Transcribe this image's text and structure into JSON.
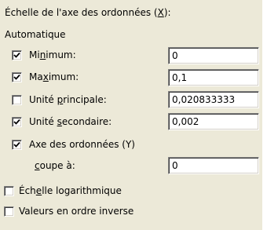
{
  "section_title": {
    "before": "Échelle de l'axe des ordonnées (",
    "key": "X",
    "after": "):"
  },
  "group_label": "Automatique",
  "rows": [
    {
      "label_before": "Mi",
      "label_key": "n",
      "label_after": "imum:",
      "checked": true,
      "value": "0"
    },
    {
      "label_before": "Ma",
      "label_key": "x",
      "label_after": "imum:",
      "checked": true,
      "value": "0,1"
    },
    {
      "label_before": "Unité ",
      "label_key": "p",
      "label_after": "rincipale:",
      "checked": false,
      "value": "0,020833333"
    },
    {
      "label_before": "Unité ",
      "label_key": "s",
      "label_after": "econdaire:",
      "checked": true,
      "value": "0,002"
    }
  ],
  "crosses": {
    "label": "Axe des ordonnées (Y)",
    "checked": true,
    "sub_label_key": "c",
    "sub_label_after": "oupe à:",
    "value": "0"
  },
  "options": [
    {
      "label_before": "Éch",
      "label_key": "e",
      "label_after": "lle logarithmique",
      "checked": false
    },
    {
      "label_before": "",
      "label_key": "",
      "label_after": "Valeurs en ordre inverse",
      "checked": false
    }
  ],
  "icons": {
    "checkmark": "check-icon"
  },
  "colors": {
    "dialog_bg": "#ece9d8",
    "field_bg": "#ffffff",
    "text": "#000000"
  }
}
